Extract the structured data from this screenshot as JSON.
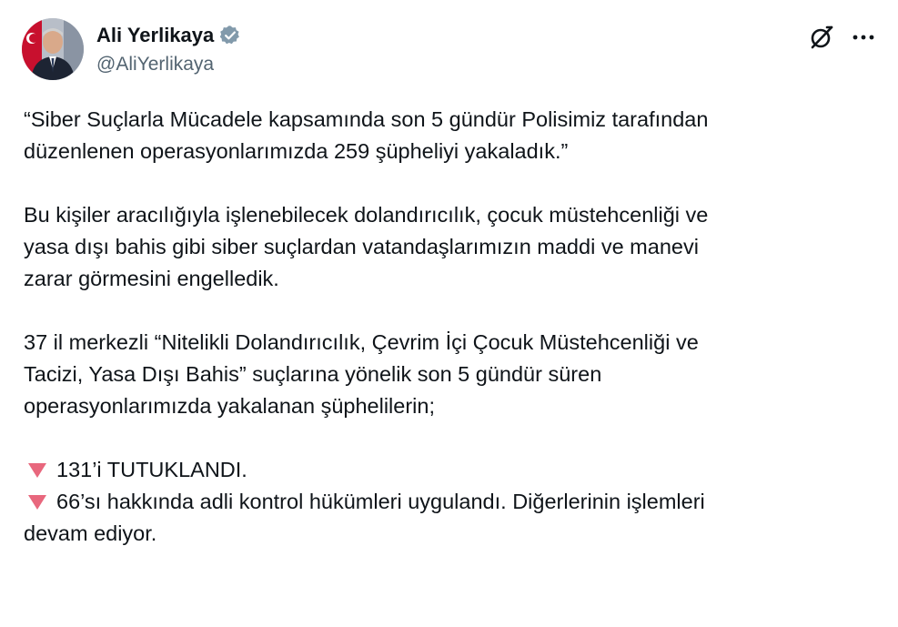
{
  "author": {
    "display_name": "Ali Yerlikaya",
    "handle": "@AliYerlikaya",
    "verified_icon": "verified-badge-icon",
    "verified_color": "#829aab"
  },
  "actions": {
    "grok_icon": "grok-icon",
    "more_icon": "more-dots-icon"
  },
  "tweet": {
    "p1_line1": "“Siber Suçlarla Mücadele kapsamında son 5 gündür Polisimiz tarafından",
    "p1_line2": "düzenlenen operasyonlarımızda 259 şüpheliyi yakaladık.”",
    "p2_line1": "Bu kişiler aracılığıyla işlenebilecek dolandırıcılık, çocuk müstehcenliği ve",
    "p2_line2": "yasa dışı bahis gibi siber suçlardan vatandaşlarımızın maddi ve manevi",
    "p2_line3": "zarar görmesini engelledik.",
    "p3_line1": "37 il merkezli “Nitelikli Dolandırıcılık, Çevrim İçi Çocuk Müstehcenliği ve",
    "p3_line2": "Tacizi, Yasa Dışı Bahis” suçlarına yönelik son 5 gündür süren",
    "p3_line3": "operasyonlarımızda yakalanan şüphelilerin;",
    "bullet1": "131’i TUTUKLANDI.",
    "bullet2_line1": "66’sı hakkında adli kontrol hükümleri uygulandı. Diğerlerinin işlemleri",
    "bullet2_line2": "devam ediyor.",
    "bullet_icon": "red-triangle-down-icon",
    "bullet_color": "#e8677d"
  }
}
